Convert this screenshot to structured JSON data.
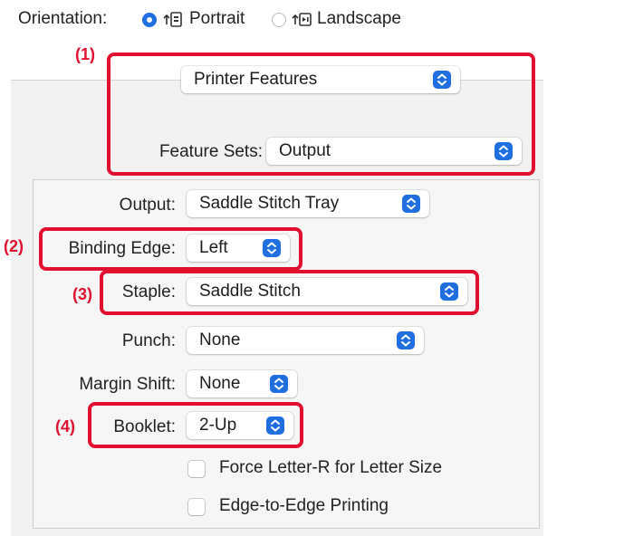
{
  "orientation": {
    "label": "Orientation:",
    "options": [
      {
        "label": "Portrait",
        "selected": true,
        "icon": "portrait-orientation-icon"
      },
      {
        "label": "Landscape",
        "selected": false,
        "icon": "landscape-orientation-icon"
      }
    ]
  },
  "panel_menu": {
    "value": "Printer Features"
  },
  "feature_sets": {
    "label": "Feature Sets:",
    "value": "Output"
  },
  "settings": {
    "output": {
      "label": "Output:",
      "value": "Saddle Stitch Tray"
    },
    "binding_edge": {
      "label": "Binding Edge:",
      "value": "Left"
    },
    "staple": {
      "label": "Staple:",
      "value": "Saddle Stitch"
    },
    "punch": {
      "label": "Punch:",
      "value": "None"
    },
    "margin_shift": {
      "label": "Margin Shift:",
      "value": "None"
    },
    "booklet": {
      "label": "Booklet:",
      "value": "2-Up"
    }
  },
  "checkboxes": [
    {
      "label": "Force Letter-R for Letter Size",
      "checked": false
    },
    {
      "label": "Edge-to-Edge Printing",
      "checked": false
    }
  ],
  "callouts": [
    "(1)",
    "(2)",
    "(3)",
    "(4)"
  ],
  "colors": {
    "accent": "#1f6fe0",
    "highlight": "#e0102e"
  }
}
